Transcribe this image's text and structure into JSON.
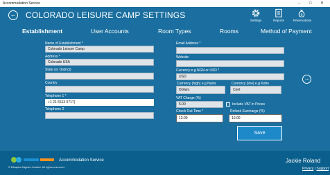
{
  "window": {
    "app_title": "Accommodation Service"
  },
  "header": {
    "title": "COLORADO LEISURE CAMP SETTINGS",
    "actions": [
      {
        "label": "Settings",
        "icon": "gear-icon"
      },
      {
        "label": "Reports",
        "icon": "document-icon"
      },
      {
        "label": "Reservations",
        "icon": "money-bag-icon"
      }
    ]
  },
  "tabs": [
    {
      "label": "Establishment",
      "active": true
    },
    {
      "label": "User Accounts",
      "active": false
    },
    {
      "label": "Room Types",
      "active": false
    },
    {
      "label": "Rooms",
      "active": false
    },
    {
      "label": "Method of Payment",
      "active": false
    }
  ],
  "form": {
    "name_label": "Name of Establishment *",
    "name_value": "Colorado Leisure Camp",
    "address_label": "Address *",
    "address_value": "Colorado USA",
    "state_label": "State (or District)",
    "state_value": "",
    "country_label": "Country",
    "country_value": "",
    "telephone1_label": "Telephone 1 *",
    "telephone1_value": "+1 21 6513 0717|",
    "telephone2_label": "Telephone 2",
    "telephone2_value": "",
    "email_label": "Email Address *",
    "email_value": "",
    "website_label": "Website",
    "website_value": "",
    "currency_label": "Currency e.g NGN or USD *",
    "currency_value": "USD",
    "currency_high_label": "Currency (high) e.g Naira",
    "currency_high_value": "Dollars",
    "currency_low_label": "Currency (low) e.g Kobo",
    "currency_low_value": "Cent",
    "vat_label": "VAT Charge (%)",
    "vat_value": "5.00",
    "include_vat_label": "Include VAT in Prices",
    "include_vat_checked": false,
    "checkout_label": "Check Out Time *",
    "checkout_value": "12:00",
    "refund_label": "Refund Surcharge (%)",
    "refund_value": "10.00",
    "save_label": "Save"
  },
  "footer": {
    "brand": "Accommodation Service",
    "copyright": "© Bluapha Nigeria Limited. All rights reserved.",
    "user_name": "Jackie Roland",
    "privacy_label": "Privacy",
    "separator": "|",
    "support_label": "Support"
  },
  "colors": {
    "background": "#1a6fa0",
    "footer": "#0b5f8c",
    "save_button": "#1d89c9",
    "input_fill": "#dfe4e8"
  }
}
